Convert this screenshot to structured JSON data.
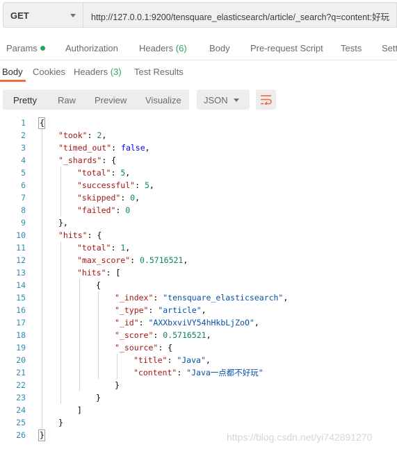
{
  "request": {
    "method": "GET",
    "url": "http://127.0.0.1:9200/tensquare_elasticsearch/article/_search?q=content:好玩"
  },
  "request_tabs": [
    {
      "label": "Params",
      "dot": true
    },
    {
      "label": "Authorization"
    },
    {
      "label": "Headers",
      "count": "(6)"
    },
    {
      "label": "Body"
    },
    {
      "label": "Pre-request Script"
    },
    {
      "label": "Tests"
    },
    {
      "label": "Sett"
    }
  ],
  "response_tabs": [
    {
      "label": "Body",
      "active": true
    },
    {
      "label": "Cookies"
    },
    {
      "label": "Headers",
      "count": "(3)"
    },
    {
      "label": "Test Results"
    }
  ],
  "view_modes": [
    "Pretty",
    "Raw",
    "Preview",
    "Visualize"
  ],
  "active_view": "Pretty",
  "format": "JSON",
  "icons": {
    "method_dropdown": "chevron-down-icon",
    "format_dropdown": "chevron-down-icon",
    "wrap": "wrap-lines-icon"
  },
  "colors": {
    "accent": "#f26b3a",
    "success": "#26a65b",
    "key": "#a31515",
    "string": "#0451a5",
    "number": "#098658",
    "boolean": "#0000ff",
    "line_number": "#2b91af"
  },
  "code_lines": [
    [
      [
        "p",
        "{"
      ]
    ],
    [
      [
        "k",
        "\"took\""
      ],
      [
        "p",
        ": "
      ],
      [
        "n",
        "2"
      ],
      [
        "p",
        ","
      ]
    ],
    [
      [
        "k",
        "\"timed_out\""
      ],
      [
        "p",
        ": "
      ],
      [
        "b",
        "false"
      ],
      [
        "p",
        ","
      ]
    ],
    [
      [
        "k",
        "\"_shards\""
      ],
      [
        "p",
        ": {"
      ]
    ],
    [
      [
        "k",
        "\"total\""
      ],
      [
        "p",
        ": "
      ],
      [
        "n",
        "5"
      ],
      [
        "p",
        ","
      ]
    ],
    [
      [
        "k",
        "\"successful\""
      ],
      [
        "p",
        ": "
      ],
      [
        "n",
        "5"
      ],
      [
        "p",
        ","
      ]
    ],
    [
      [
        "k",
        "\"skipped\""
      ],
      [
        "p",
        ": "
      ],
      [
        "n",
        "0"
      ],
      [
        "p",
        ","
      ]
    ],
    [
      [
        "k",
        "\"failed\""
      ],
      [
        "p",
        ": "
      ],
      [
        "n",
        "0"
      ]
    ],
    [
      [
        "p",
        "},"
      ]
    ],
    [
      [
        "k",
        "\"hits\""
      ],
      [
        "p",
        ": {"
      ]
    ],
    [
      [
        "k",
        "\"total\""
      ],
      [
        "p",
        ": "
      ],
      [
        "n",
        "1"
      ],
      [
        "p",
        ","
      ]
    ],
    [
      [
        "k",
        "\"max_score\""
      ],
      [
        "p",
        ": "
      ],
      [
        "n",
        "0.5716521"
      ],
      [
        "p",
        ","
      ]
    ],
    [
      [
        "k",
        "\"hits\""
      ],
      [
        "p",
        ": ["
      ]
    ],
    [
      [
        "p",
        "{"
      ]
    ],
    [
      [
        "k",
        "\"_index\""
      ],
      [
        "p",
        ": "
      ],
      [
        "s",
        "\"tensquare_elasticsearch\""
      ],
      [
        "p",
        ","
      ]
    ],
    [
      [
        "k",
        "\"_type\""
      ],
      [
        "p",
        ": "
      ],
      [
        "s",
        "\"article\""
      ],
      [
        "p",
        ","
      ]
    ],
    [
      [
        "k",
        "\"_id\""
      ],
      [
        "p",
        ": "
      ],
      [
        "s",
        "\"AXXbxviVY54hHkbLjZoO\""
      ],
      [
        "p",
        ","
      ]
    ],
    [
      [
        "k",
        "\"_score\""
      ],
      [
        "p",
        ": "
      ],
      [
        "n",
        "0.5716521"
      ],
      [
        "p",
        ","
      ]
    ],
    [
      [
        "k",
        "\"_source\""
      ],
      [
        "p",
        ": {"
      ]
    ],
    [
      [
        "k",
        "\"title\""
      ],
      [
        "p",
        ": "
      ],
      [
        "s",
        "\"Java\""
      ],
      [
        "p",
        ","
      ]
    ],
    [
      [
        "k",
        "\"content\""
      ],
      [
        "p",
        ": "
      ],
      [
        "s",
        "\"Java一点都不好玩\""
      ]
    ],
    [
      [
        "p",
        "}"
      ]
    ],
    [
      [
        "p",
        "}"
      ]
    ],
    [
      [
        "p",
        "]"
      ]
    ],
    [
      [
        "p",
        "}"
      ]
    ],
    [
      [
        "p",
        "}"
      ]
    ]
  ],
  "watermark": "https://blog.csdn.net/yi742891270"
}
